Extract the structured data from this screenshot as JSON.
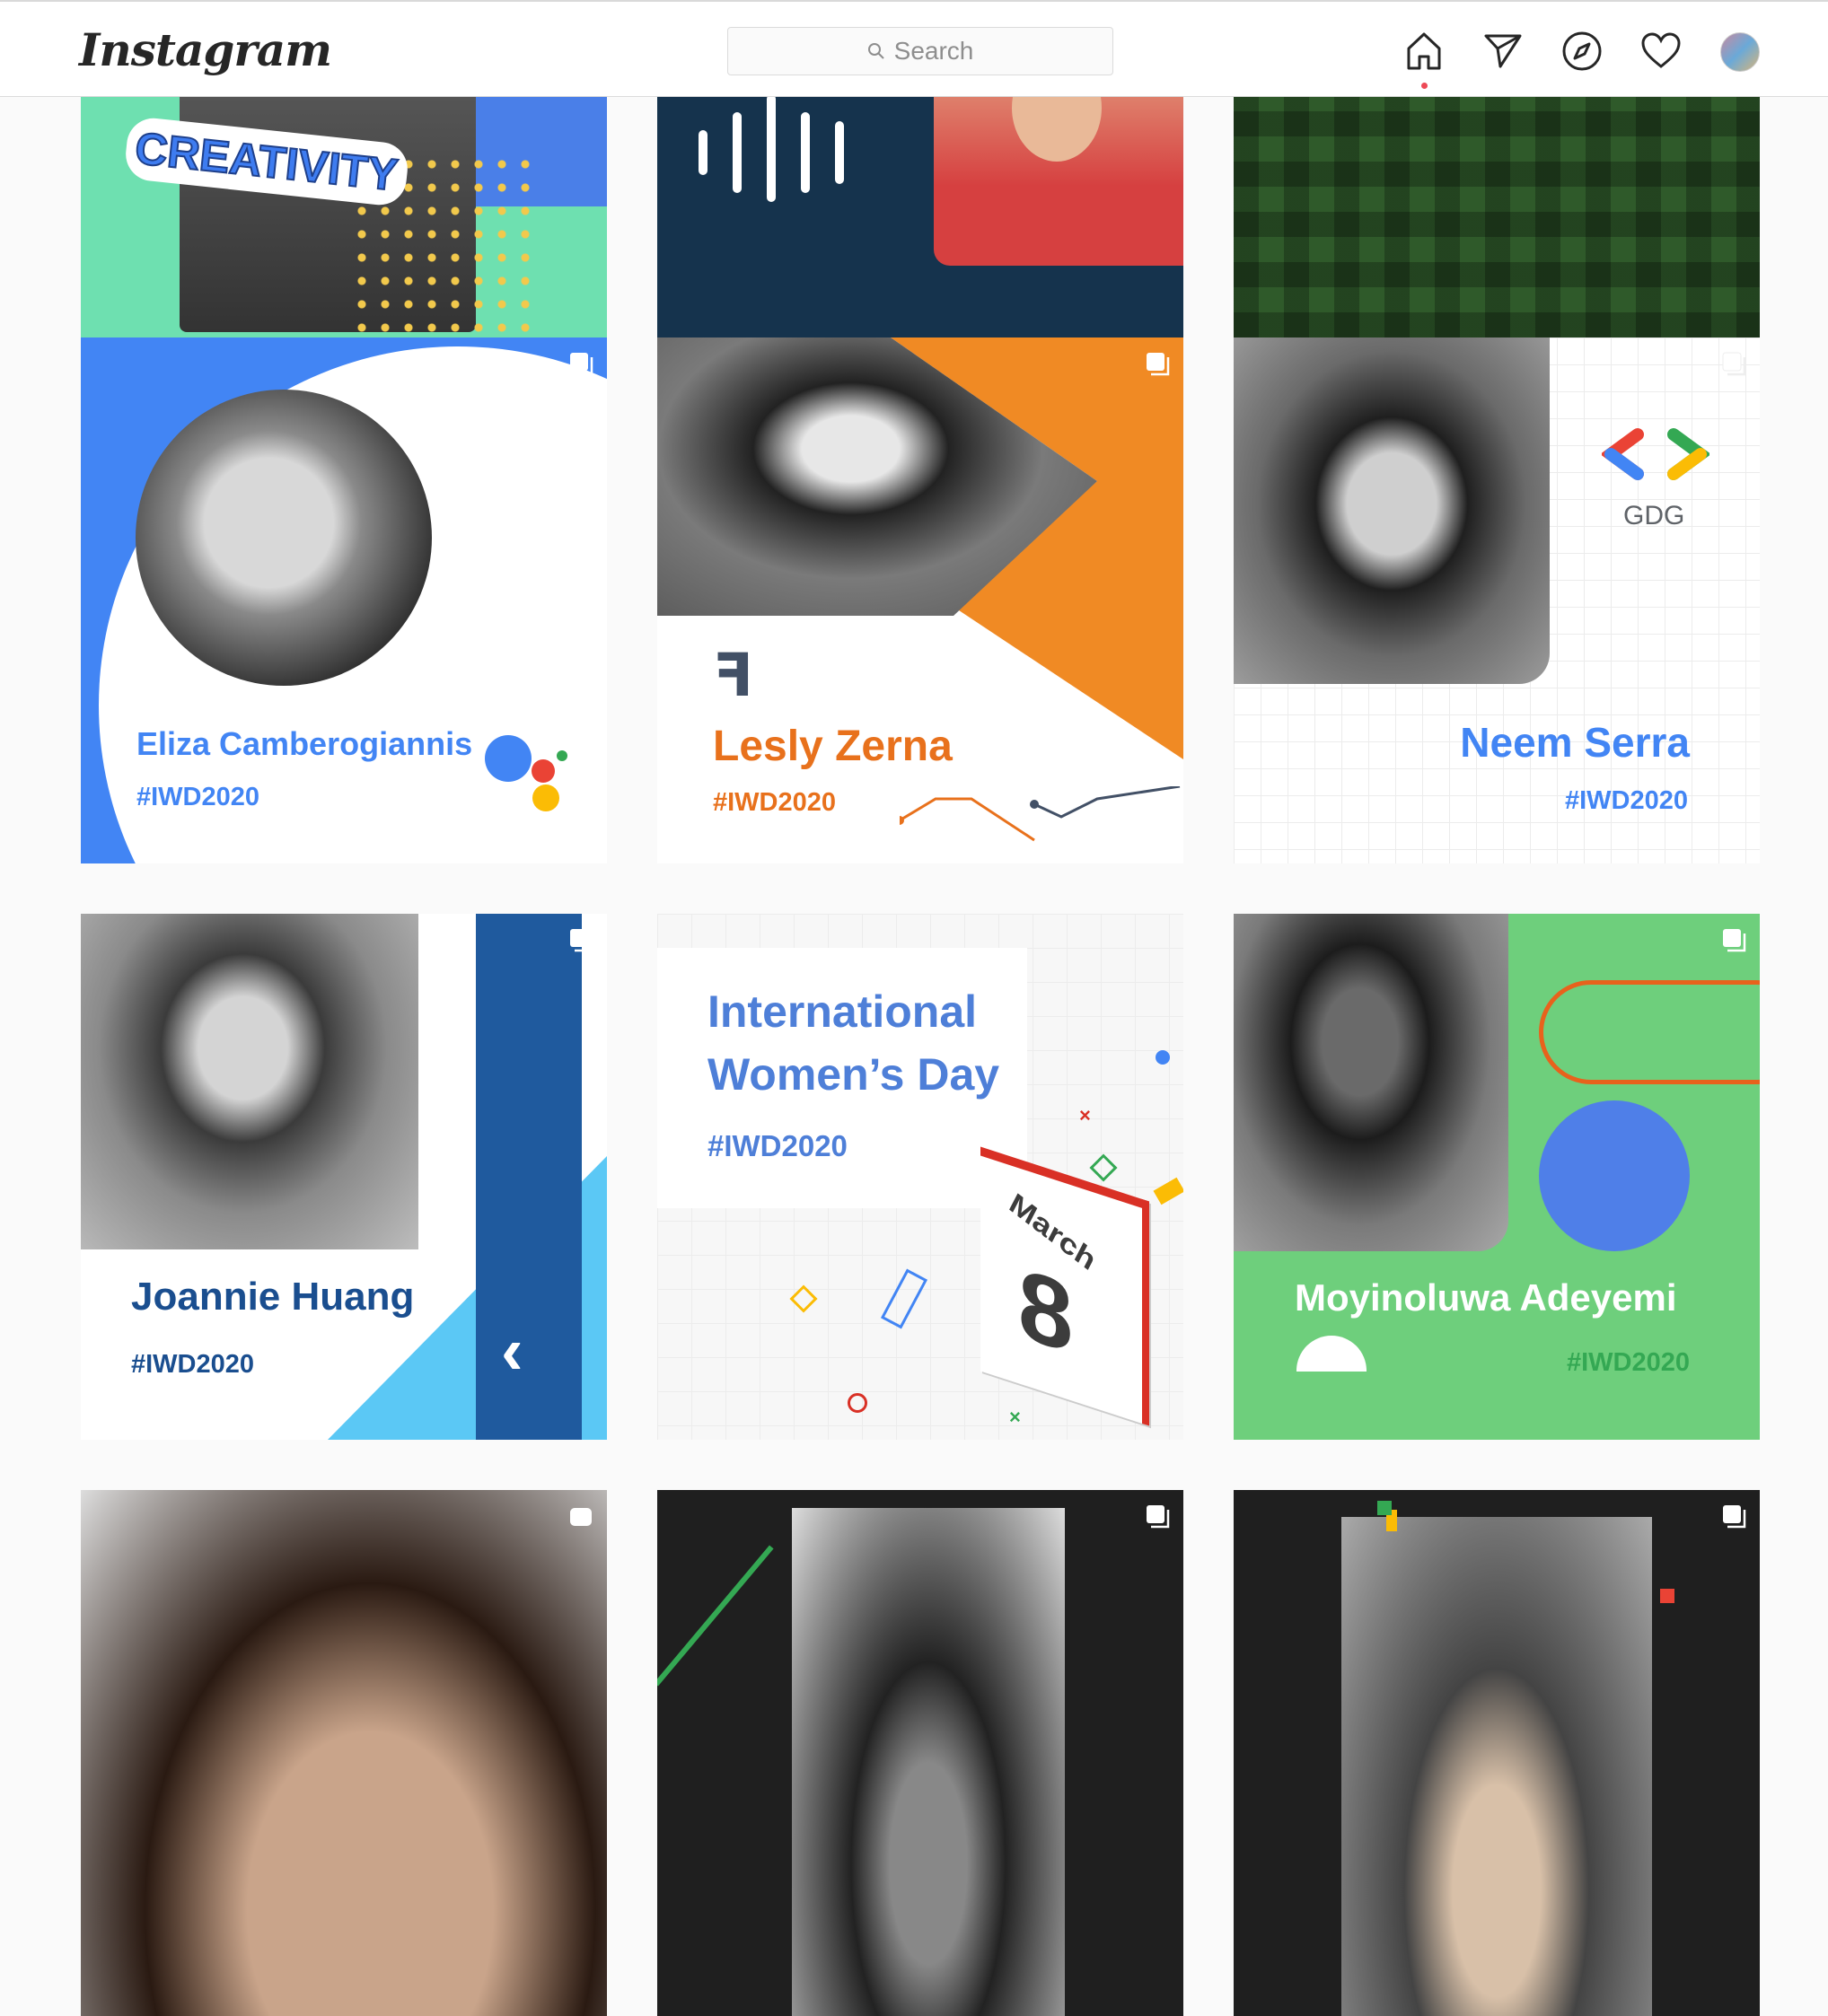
{
  "header": {
    "logo": "Instagram",
    "search_placeholder": "Search"
  },
  "nav": [
    "home-icon",
    "direct-icon",
    "explore-icon",
    "activity-icon",
    "profile-avatar"
  ],
  "posts_top": [
    {
      "text": "CREATIVITY"
    },
    {
      "text": ""
    },
    {
      "text": ""
    }
  ],
  "posts": [
    {
      "name": "Eliza Camberogiannis",
      "tag": "#IWD2020",
      "color": "#4285f4"
    },
    {
      "name": "Lesly Zerna",
      "tag": "#IWD2020",
      "color": "#e8711c"
    },
    {
      "name": "Neem Serra",
      "tag": "#IWD2020",
      "color": "#4285f4",
      "badge": "GDG"
    },
    {
      "name": "Joannie Huang",
      "tag": "#IWD2020",
      "color": "#1a4e8f"
    },
    {
      "title_line1": "International",
      "title_line2": "Women’s Day",
      "tag": "#IWD2020",
      "month": "March",
      "day": "8",
      "color": "#4e7fd8"
    },
    {
      "name": "Moyinoluwa Adeyemi",
      "tag": "#IWD2020",
      "color": "#ffffff"
    }
  ]
}
